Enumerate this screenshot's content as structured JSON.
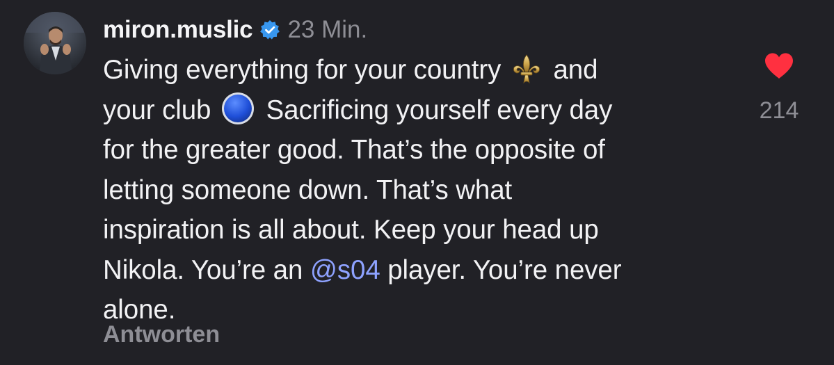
{
  "comment": {
    "author": {
      "username": "miron.muslic",
      "verified": true,
      "avatar": "profile-photo"
    },
    "timestamp": "23 Min.",
    "text_lines": {
      "l1a": "Giving everything for your country",
      "l1b": "and",
      "l2a": "your club",
      "l2b": "Sacrificing yourself every day",
      "l3": "for the greater good. That’s the opposite of",
      "l4": "letting someone down. That’s what",
      "l5": "inspiration is all about. Keep your head up",
      "l6a": "Nikola. You’re an",
      "l6_mention": "@s04",
      "l6b": "player. You’re never",
      "l7": "alone."
    },
    "emojis": [
      "fleur-de-lis",
      "blue-circle"
    ],
    "reply_label": "Antworten",
    "likes": {
      "count": "214",
      "liked": true,
      "icon": "heart-icon"
    }
  },
  "colors": {
    "background": "#212126",
    "text": "#f2f2f4",
    "muted": "#8e8e95",
    "mention": "#8ea2ff",
    "verified": "#3897f0",
    "heart": "#ff3040"
  }
}
